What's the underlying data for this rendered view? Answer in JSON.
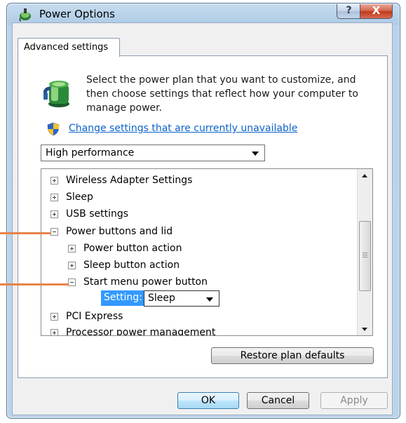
{
  "window": {
    "title": "Power Options",
    "help_glyph": "?",
    "close_glyph": "X"
  },
  "tab": {
    "label": "Advanced settings"
  },
  "intro": {
    "text": "Select the power plan that you want to customize, and then choose settings that reflect how your computer to manage power."
  },
  "change_link": {
    "label": "Change settings that are currently unavailable"
  },
  "plan_select": {
    "value": "High performance"
  },
  "tree": {
    "rows": [
      {
        "label": "Wireless Adapter Settings",
        "expander": "plus"
      },
      {
        "label": "Sleep",
        "expander": "plus"
      },
      {
        "label": "USB settings",
        "expander": "plus"
      },
      {
        "label": "Power buttons and lid",
        "expander": "minus"
      },
      {
        "label": "Power button action",
        "expander": "plus"
      },
      {
        "label": "Sleep button action",
        "expander": "plus"
      },
      {
        "label": "Start menu power button",
        "expander": "minus"
      },
      {
        "label": "PCI Express",
        "expander": "plus"
      },
      {
        "label": "Processor power management",
        "expander": "plus"
      }
    ],
    "setting_label": "Setting:",
    "setting_value": "Sleep"
  },
  "buttons": {
    "restore": "Restore plan defaults",
    "ok": "OK",
    "cancel": "Cancel",
    "apply": "Apply"
  },
  "icons": {
    "title": "power-plug-icon",
    "plan": "battery-plug-icon",
    "shield": "uac-shield-icon"
  },
  "colors": {
    "link": "#0b63c9",
    "callout": "#e8834b",
    "selection": "#3399ff",
    "close_button": "#c1391c"
  }
}
